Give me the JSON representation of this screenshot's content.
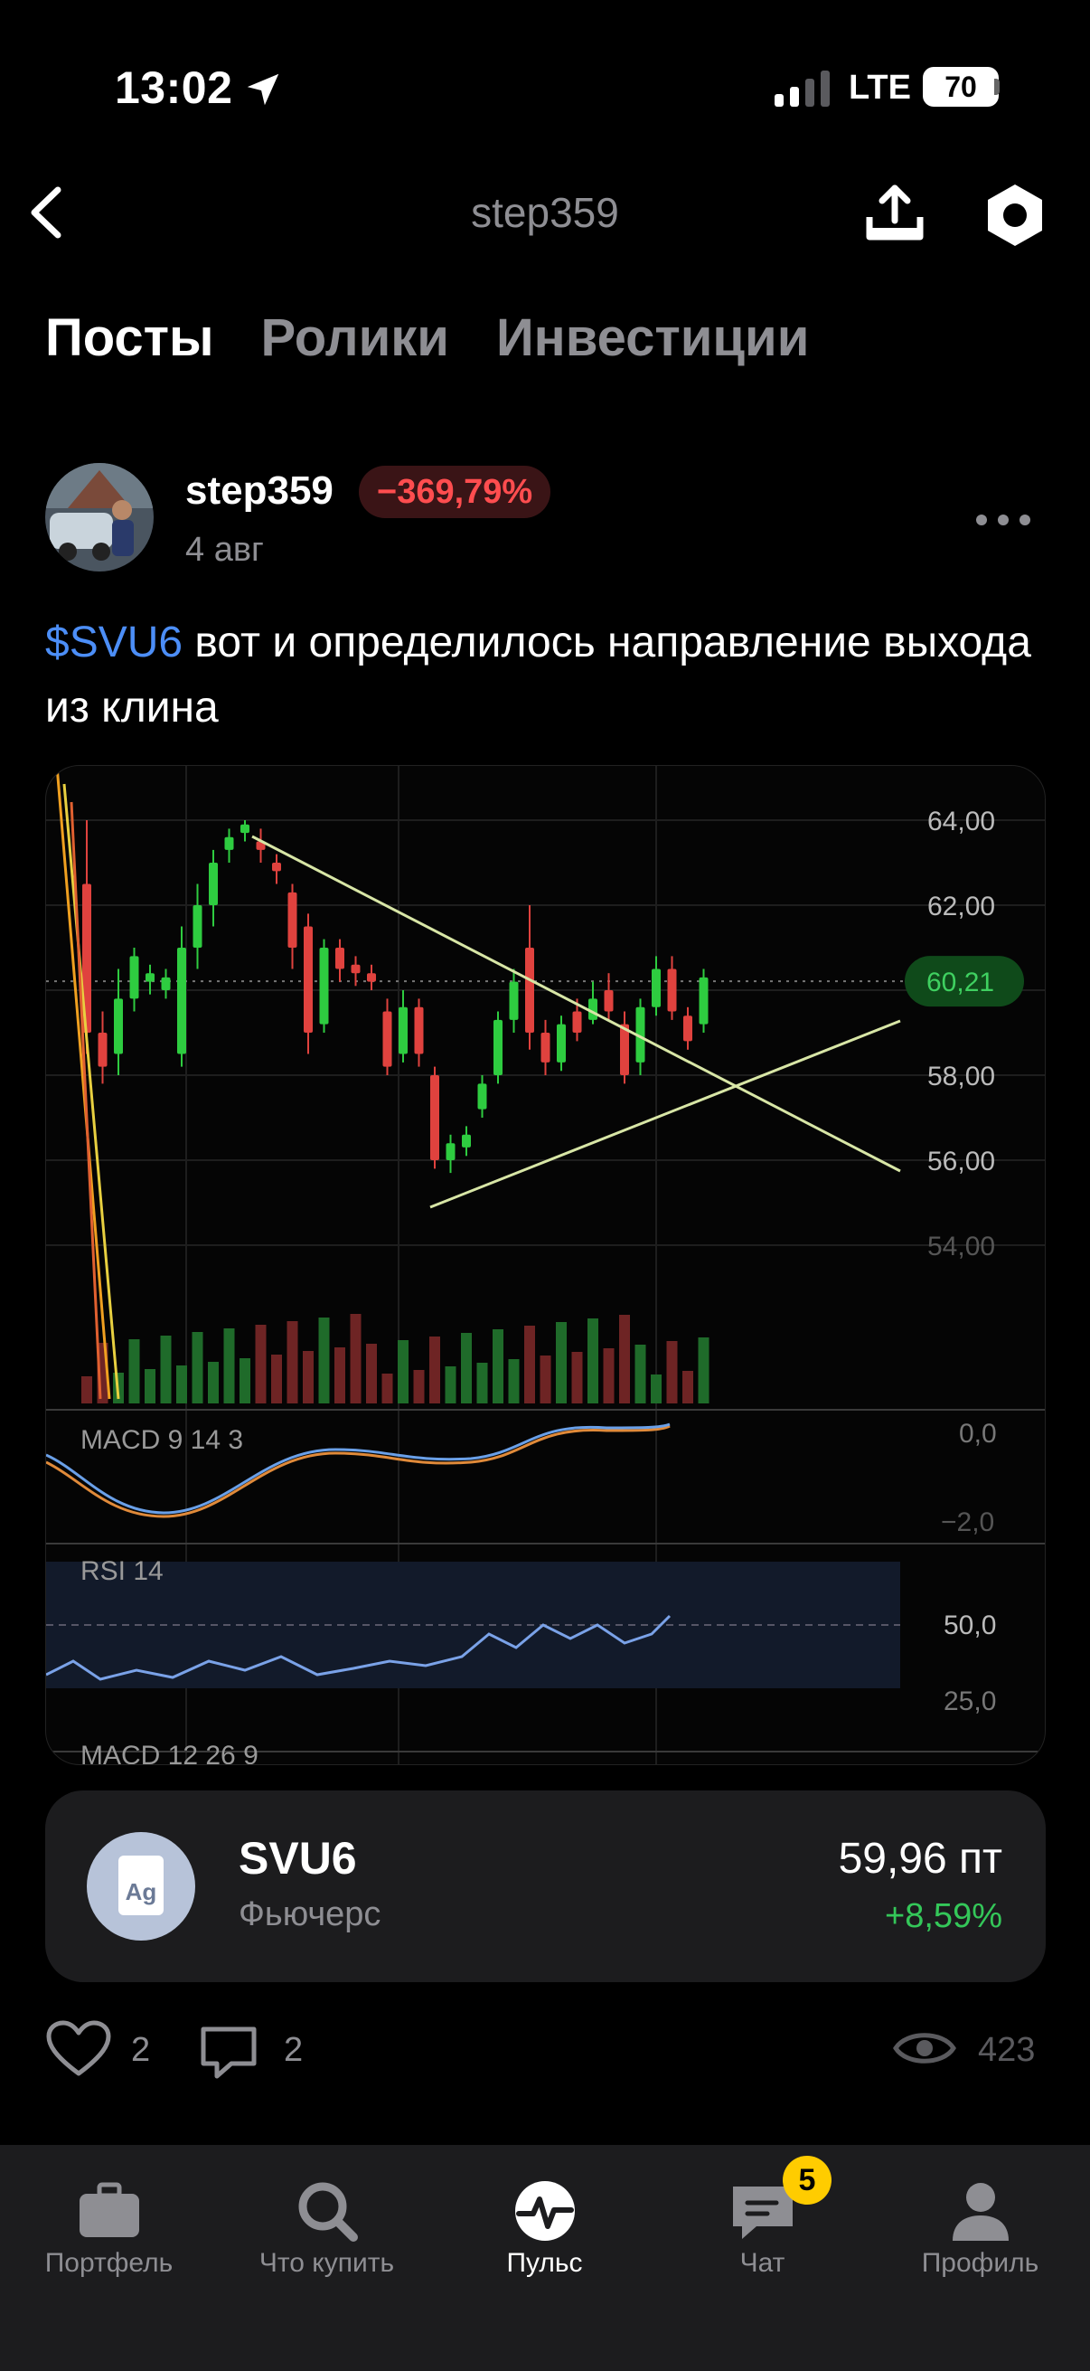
{
  "status_bar": {
    "time": "13:02",
    "network": "LTE",
    "battery": "70"
  },
  "nav": {
    "title": "step359"
  },
  "tabs": [
    {
      "label": "Посты",
      "active": true
    },
    {
      "label": "Ролики",
      "active": false
    },
    {
      "label": "Инвестиции",
      "active": false
    }
  ],
  "post": {
    "author": "step359",
    "profit_badge": "−369,79%",
    "date": "4 авг",
    "ticker": "$SVU6",
    "text": " вот и определилось направление выхода из клина"
  },
  "chart_image": {
    "price_labels": [
      "64,00",
      "62,00",
      "58,00",
      "56,00",
      "54,00"
    ],
    "current_price": "60,21",
    "macd_label": "MACD 9 14 3",
    "macd_ticks": [
      "0,0",
      "−2,0"
    ],
    "rsi_label": "RSI 14",
    "rsi_ticks": [
      "50,0",
      "25,0"
    ],
    "macd2_label": "MACD 12 26 9",
    "colors": {
      "up": "#2ecc40",
      "down": "#e0423e",
      "wedge": "#d8e6a6"
    }
  },
  "instrument": {
    "icon_text": "Ag",
    "ticker": "SVU6",
    "type": "Фьючерс",
    "price": "59,96 пт",
    "change": "+8,59%"
  },
  "actions": {
    "likes": "2",
    "comments": "2",
    "views": "423"
  },
  "bottom_nav": [
    {
      "label": "Портфель",
      "icon": "briefcase-icon"
    },
    {
      "label": "Что купить",
      "icon": "search-icon"
    },
    {
      "label": "Пульс",
      "icon": "pulse-icon",
      "active": true
    },
    {
      "label": "Чат",
      "icon": "chat-icon",
      "badge": "5"
    },
    {
      "label": "Профиль",
      "icon": "profile-icon"
    }
  ]
}
